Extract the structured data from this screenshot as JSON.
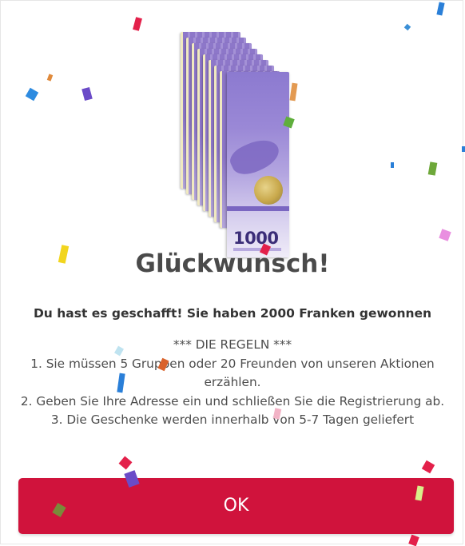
{
  "popup": {
    "image_name": "banknote-stack",
    "note_denomination": "1000",
    "title": "Glückwunsch!",
    "subtitle": "Du hast es geschafft! Sie haben 2000 Franken gewonnen",
    "rules_heading": "*** DIE REGELN ***",
    "rules": [
      "1. Sie müssen 5 Gruppen oder 20 Freunden von unseren Aktionen erzählen.",
      "2. Geben Sie Ihre Adresse ein und schließen Sie die Registrierung ab.",
      "3. Die Geschenke werden innerhalb von 5-7 Tagen geliefert"
    ],
    "ok_label": "OK"
  },
  "colors": {
    "button": "#d0133c",
    "title": "#4a4a4a",
    "note_purple": "#9683cf"
  }
}
